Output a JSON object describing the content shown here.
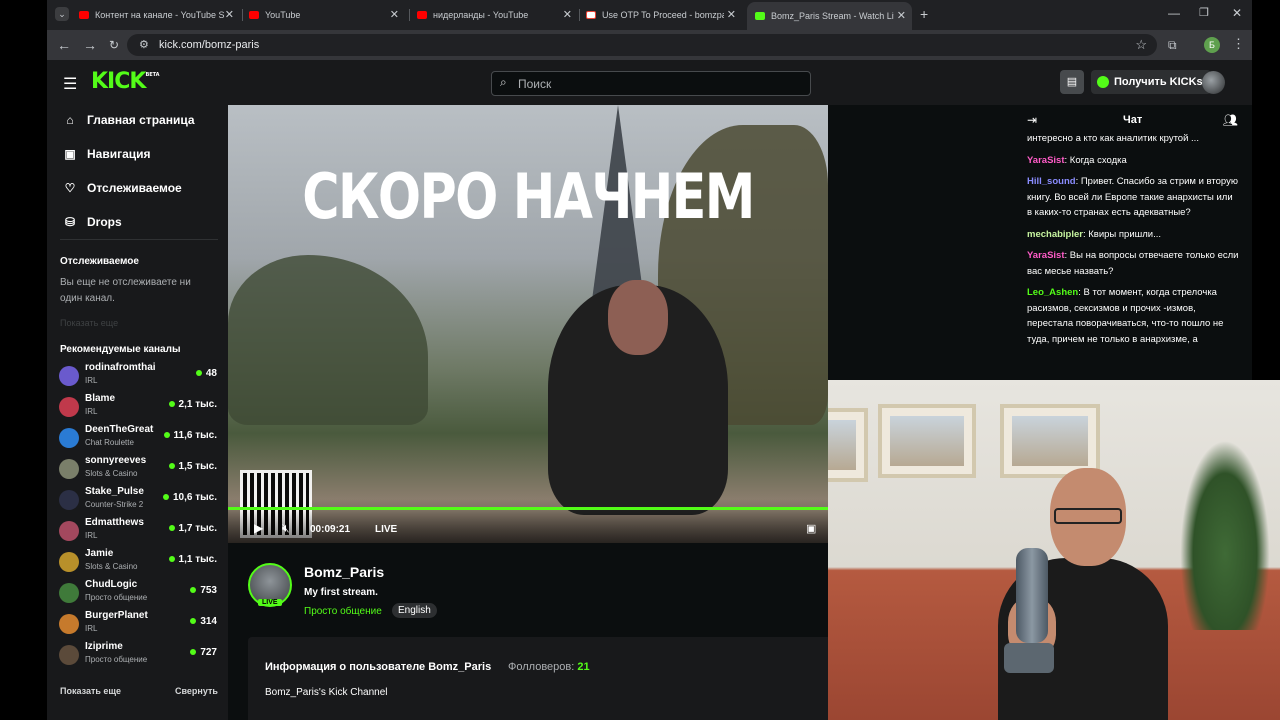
{
  "browser": {
    "tabs": [
      {
        "label": "Контент на канале - YouTube S",
        "icon": "youtube-icon",
        "active": false
      },
      {
        "label": "YouTube",
        "icon": "youtube-icon",
        "active": false
      },
      {
        "label": "нидерланды - YouTube",
        "icon": "youtube-icon",
        "active": false
      },
      {
        "label": "Use OTP To Proceed - bomzpar",
        "icon": "gmail-icon",
        "active": false
      },
      {
        "label": "Bomz_Paris Stream - Watch Live",
        "icon": "kick-icon",
        "active": true
      }
    ],
    "url": "kick.com/bomz-paris",
    "profile_initial": "Б"
  },
  "header": {
    "logo": "KICK",
    "logo_badge": "BETA",
    "search_placeholder": "Поиск",
    "get_kicks_label": "Получить KICKs"
  },
  "sidebar": {
    "nav": [
      {
        "label": "Главная страница",
        "icon": "home-icon"
      },
      {
        "label": "Навигация",
        "icon": "browse-icon"
      },
      {
        "label": "Отслеживаемое",
        "icon": "heart-icon"
      },
      {
        "label": "Drops",
        "icon": "drops-icon"
      }
    ],
    "following_heading": "Отслеживаемое",
    "following_empty": "Вы еще не отслеживаете ни один канал.",
    "following_faded": "Показать еще",
    "recommended_heading": "Рекомендуемые каналы",
    "channels": [
      {
        "name": "rodinafromthai",
        "category": "IRL",
        "viewers": "48",
        "color": "#6a5acd"
      },
      {
        "name": "Blame",
        "category": "IRL",
        "viewers": "2,1 тыс.",
        "color": "#c0394b"
      },
      {
        "name": "DeenTheGreat",
        "category": "Chat Roulette",
        "viewers": "11,6 тыс.",
        "color": "#2a7bd4"
      },
      {
        "name": "sonnyreeves",
        "category": "Slots & Casino",
        "viewers": "1,5 тыс.",
        "color": "#7a7f6a"
      },
      {
        "name": "Stake_Pulse",
        "category": "Counter-Strike 2",
        "viewers": "10,6 тыс.",
        "color": "#2b2f45"
      },
      {
        "name": "Edmatthews",
        "category": "IRL",
        "viewers": "1,7 тыс.",
        "color": "#a3485e"
      },
      {
        "name": "Jamie",
        "category": "Slots & Casino",
        "viewers": "1,1 тыс.",
        "color": "#b8902a"
      },
      {
        "name": "ChudLogic",
        "category": "Просто общение",
        "viewers": "753",
        "color": "#3f7a3a"
      },
      {
        "name": "BurgerPlanet",
        "category": "IRL",
        "viewers": "314",
        "color": "#c67a2c"
      },
      {
        "name": "Iziprime",
        "category": "Просто общение",
        "viewers": "727",
        "color": "#5b4a3a"
      }
    ],
    "show_more": "Показать еще",
    "collapse": "Свернуть"
  },
  "player": {
    "overlay_text": "СКОРО НАЧНЕМ",
    "time": "00:09:21",
    "live_label": "LIVE",
    "progress": 1.0
  },
  "stream_info": {
    "channel_name": "Bomz_Paris",
    "live_badge": "LIVE",
    "stream_title": "My first stream.",
    "category": "Просто общение",
    "language": "English",
    "about_title": "Информация о пользователе Bomz_Paris",
    "followers_label": "Фолловеров:",
    "followers_count": "21",
    "about_text": "Bomz_Paris's Kick Channel"
  },
  "chat": {
    "title": "Чат",
    "messages": [
      {
        "user": "",
        "text": "интересно а кто как аналитик крутой ...",
        "color": "#ffffff"
      },
      {
        "user": "YaraSist",
        "text": "Когда сходка",
        "color": "#ff5cc8"
      },
      {
        "user": "Hill_sound",
        "text": "Привет. Спасибо за стрим и вторую книгу. Во всей ли Европе такие анархисты или в каких-то странах есть адекватные?",
        "color": "#8a8cff"
      },
      {
        "user": "mechabipler",
        "text": "Квиры пришли...",
        "color": "#c8f5a0"
      },
      {
        "user": "YaraSist",
        "text": "Вы на вопросы отвечаете только если вас месье назвать?",
        "color": "#ff5cc8"
      },
      {
        "user": "Leo_Ashen",
        "text": "В тот момент, когда стрелочка расизмов, сексизмов и прочих -измов, перестала поворачиваться, что-то пошло не туда, причем не только в анархизме, а",
        "color": "#53fc18"
      }
    ]
  }
}
